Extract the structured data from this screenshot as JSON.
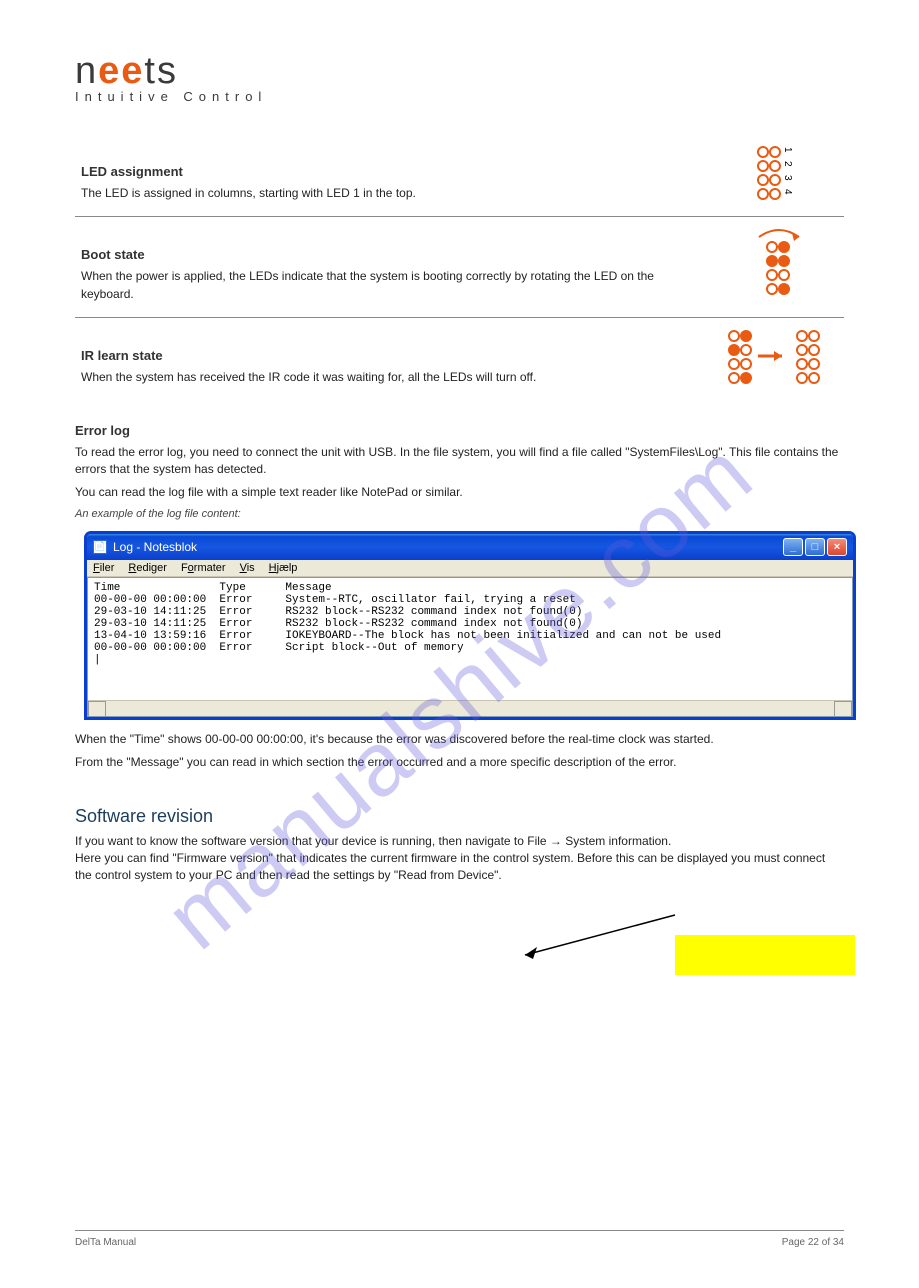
{
  "logo": {
    "line1": "neets",
    "line2": "Intuitive Control"
  },
  "row1": {
    "title": "LED assignment",
    "desc": "The LED is assigned in columns, starting with LED 1 in the top.",
    "labels": [
      "1",
      "2",
      "3",
      "4"
    ]
  },
  "row2": {
    "title": "Boot state",
    "desc": "When the power is applied, the LEDs indicate that the system is booting correctly by rotating the LED on the keyboard."
  },
  "row3": {
    "title": "IR learn state",
    "desc": "When the system has received the IR code it was waiting for, all the LEDs will turn off."
  },
  "errorLog": {
    "heading": "Error log",
    "p1": "To read the error log, you need to connect the unit with USB. In the file system, you will find a file called \"SystemFiles\\Log\". This file contains the errors that the system has detected.",
    "p2": "You can read the log file with a simple text reader like NotePad or similar.",
    "p3": "An example of the log file content:",
    "window": {
      "title": "Log - Notesblok",
      "menus": [
        "Filer",
        "Rediger",
        "Formater",
        "Vis",
        "Hjælp"
      ],
      "header": "Time               Type      Message",
      "lines": [
        "00-00-00 00:00:00  Error     System--RTC, oscillator fail, trying a reset",
        "29-03-10 14:11:25  Error     RS232 block--RS232 command index not found(0)",
        "29-03-10 14:11:25  Error     RS232 block--RS232 command index not found(0)",
        "13-04-10 13:59:16  Error     IOKEYBOARD--The block has not been initialized and can not be used",
        "00-00-00 00:00:00  Error     Script block--Out of memory"
      ]
    },
    "note": "When the \"Time\" shows 00-00-00 00:00:00, it's because the error was discovered before the real-time clock was started.",
    "messages": "From the \"Message\" you can read in which section the error occurred and a more specific description of the error."
  },
  "softwareSection": {
    "heading": "Software revision",
    "p1": "If you want to know the software version that your device is running, then navigate to File → System information.\nHere you can find \"Firmware version\" that indicates the current firmware in the control system. Before this can be displayed you must connect the control system to your PC and then read the settings by \"Read from Device\"."
  },
  "watermark": "manualshive.com",
  "footer": {
    "left": "DelTa Manual",
    "right": "Page 22 of 34"
  }
}
